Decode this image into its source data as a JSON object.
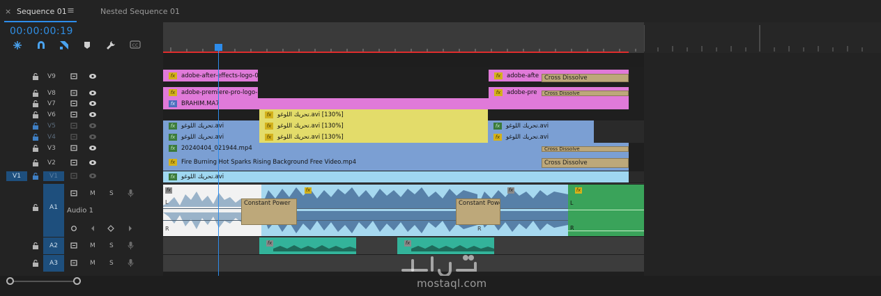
{
  "tabs": [
    {
      "label": "Sequence 01",
      "active": true
    },
    {
      "label": "Nested Sequence 01",
      "active": false
    }
  ],
  "close_glyph": "×",
  "menu_glyph": "≡",
  "timecode": "00:00:00:19",
  "video_tracks": [
    {
      "id": "V9",
      "locked": false
    },
    {
      "id": "V8",
      "locked": false
    },
    {
      "id": "V7",
      "locked": false
    },
    {
      "id": "V6",
      "locked": false
    },
    {
      "id": "V5",
      "locked": true
    },
    {
      "id": "V4",
      "locked": true
    },
    {
      "id": "V3",
      "locked": false
    },
    {
      "id": "V2",
      "locked": false
    },
    {
      "id": "V1",
      "locked": true,
      "source_patch": "V1"
    }
  ],
  "audio_tracks": [
    {
      "id": "A1",
      "name": "Audio 1",
      "controls": [
        "M",
        "S"
      ]
    },
    {
      "id": "A2",
      "controls": [
        "M",
        "S"
      ]
    },
    {
      "id": "A3",
      "controls": [
        "M",
        "S"
      ]
    }
  ],
  "clips": {
    "v9_a": "adobe-after-effects-logo-0",
    "v9_b": "adobe-afte",
    "v8_a": "adobe-premiere-pro-logo-",
    "v8_b": "adobe-pre",
    "v7": "BRAHIM.MA7",
    "v6": "تحريك اللوغو.avi [130%]",
    "v5_a": "تحريك اللوغو.avi",
    "v5_b": "تحريك اللوغو.avi [130%]",
    "v5_c": "تحريك اللوغو.avi",
    "v4_a": "تحريك اللوغو.avi",
    "v4_b": "تحريك اللوغو.avi [130%]",
    "v4_c": "تحريك اللوغو.avi",
    "v3": "20240404_021944.mp4",
    "v2": "Fire Burning Hot Sparks Rising Background Free Video.mp4",
    "v1": "تحريك اللوغو.avi"
  },
  "transitions": {
    "cross_dissolve": "Cross Dissolve",
    "constant_power": "Constant Power"
  },
  "channel_labels": {
    "left": "L",
    "right": "R"
  },
  "fx_label": "fx",
  "watermark": {
    "text": "mostaql.com"
  },
  "colors": {
    "accent": "#2d8ceb",
    "pink": "#e07ad9",
    "yellow": "#e3dc6a",
    "blue_clip": "#7b9fd3",
    "cyan_clip": "#9fd7f1",
    "audio_blue": "#a6d8ef",
    "audio_green": "#3aa35a",
    "red_line": "#e02d2d"
  }
}
